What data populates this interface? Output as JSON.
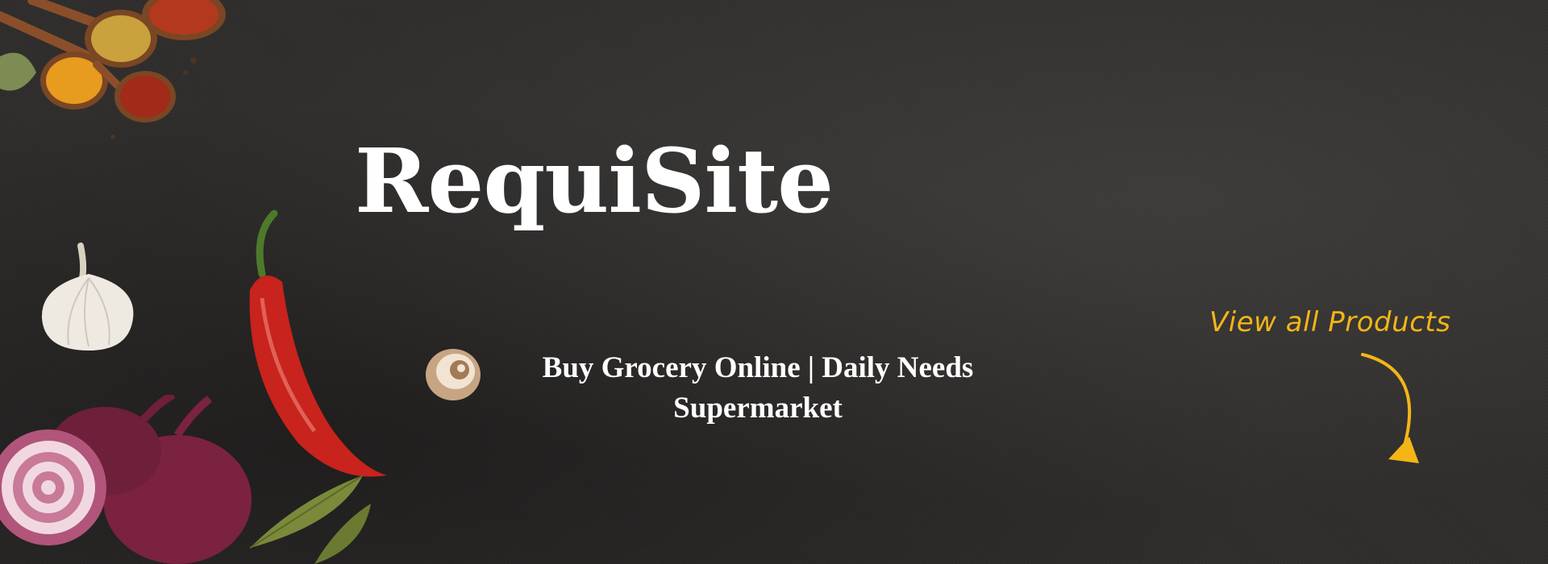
{
  "brand": {
    "name": "RequiSite"
  },
  "tagline": "Buy Grocery Online | Daily Needs Supermarket",
  "cta": {
    "label": "View all Products"
  },
  "colors": {
    "background": "#2f2d2c",
    "text": "#ffffff",
    "accent": "#f3b616"
  },
  "decor": {
    "spices": "spice-spoons-icon",
    "garlic": "garlic-icon",
    "chili": "red-chili-icon",
    "onions": "red-onion-icon",
    "leaves": "bay-leaf-icon",
    "mushroom": "mushroom-icon",
    "arrow": "curved-arrow-icon"
  }
}
